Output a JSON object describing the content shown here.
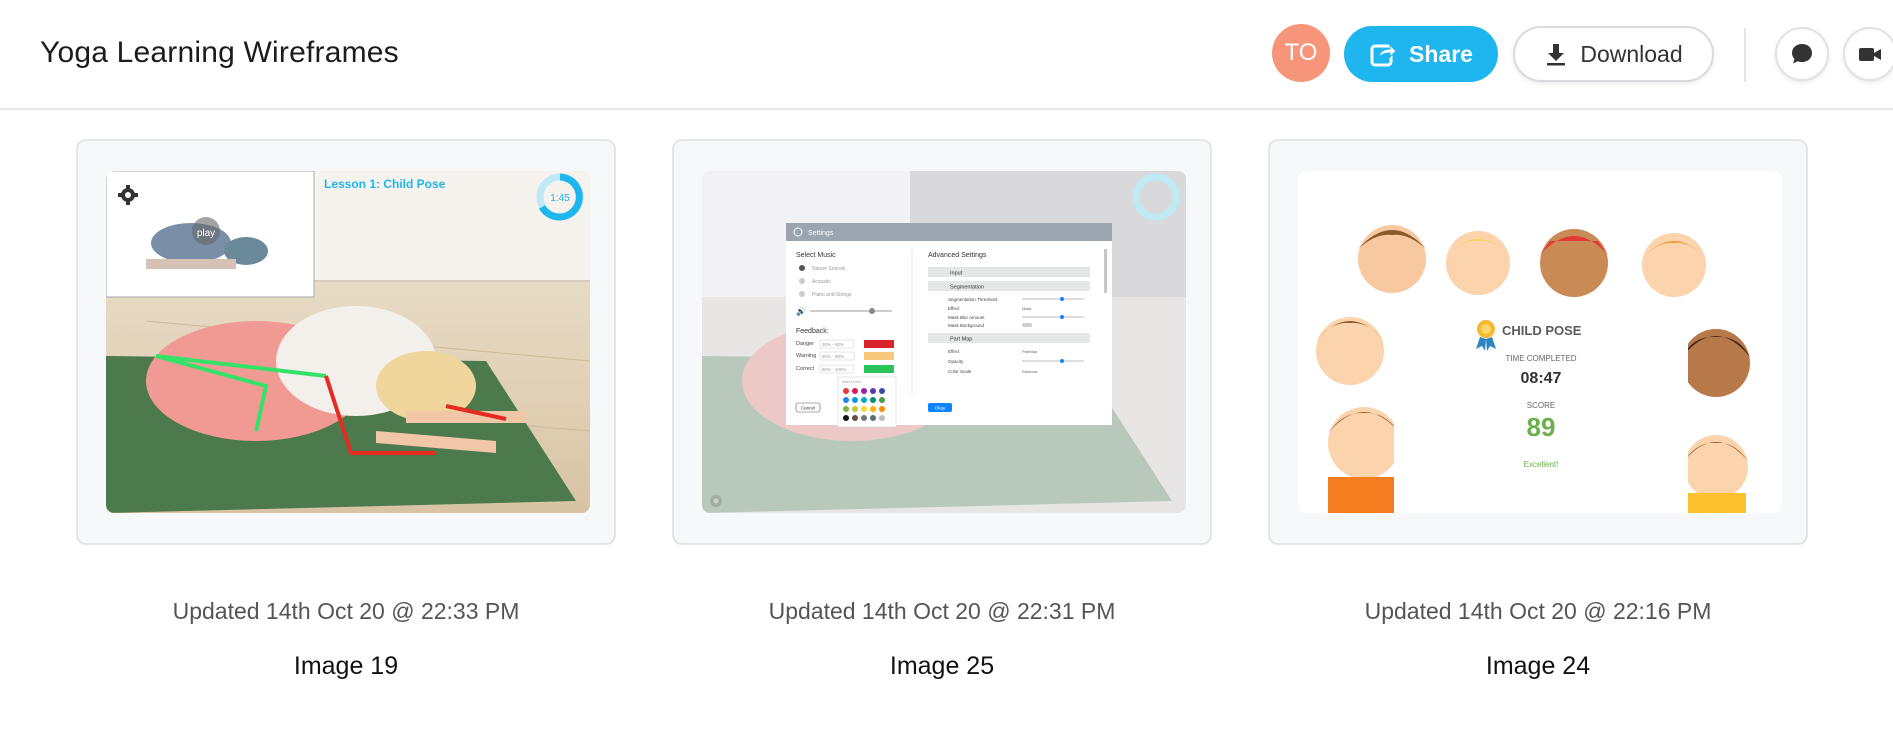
{
  "header": {
    "title": "Yoga Learning Wireframes",
    "avatar_initials": "TO",
    "avatar_color": "#f7957a",
    "share_label": "Share",
    "download_label": "Download",
    "accent_color": "#1fb5ee",
    "icons": [
      "share-icon",
      "download-icon",
      "comment-icon",
      "video-icon"
    ]
  },
  "cards": [
    {
      "updated": "Updated 14th Oct 20 @ 22:33 PM",
      "name": "Image 19",
      "thumb": {
        "lesson_title": "Lesson 1: Child Pose",
        "timer": "1:45",
        "play_label": "play"
      }
    },
    {
      "updated": "Updated 14th Oct 20 @ 22:31 PM",
      "name": "Image 25",
      "thumb": {
        "dialog_title": "Settings",
        "select_music": "Select Music",
        "music_options": [
          "Nature Sounds",
          "Acoustic",
          "Piano and Strings"
        ],
        "feedback_label": "Feedback:",
        "feedback_rows": [
          {
            "label": "Danger",
            "range": "30% - 50%",
            "color": "#d9252a"
          },
          {
            "label": "Warning",
            "range": "50% - 80%",
            "color": "#f7c77b"
          },
          {
            "label": "Correct",
            "range": "80% - 100%",
            "color": "#28c45a"
          }
        ],
        "select_color": "Select Color",
        "advanced_title": "Advanced Settings",
        "sections": [
          "Input",
          "Segmentation",
          "Part Map"
        ],
        "segmentation_fields": [
          "Segmentation Threshold",
          "Effect",
          "Mask Blur Amount",
          "Mask Background"
        ],
        "segmentation_effect": "Mask",
        "partmap_fields": [
          "Effect",
          "Opacity",
          "Color Scale"
        ],
        "partmap_effect": "PartMap",
        "partmap_colorscale": "Rainbow",
        "cancel_label": "Cancel",
        "okay_label": "Okay"
      }
    },
    {
      "updated": "Updated 14th Oct 20 @ 22:16 PM",
      "name": "Image 24",
      "thumb": {
        "pose_title": "CHILD POSE",
        "time_label": "TIME COMPLETED",
        "time_value": "08:47",
        "score_label": "SCORE",
        "score_value": "89",
        "message": "Excellent!"
      }
    }
  ]
}
